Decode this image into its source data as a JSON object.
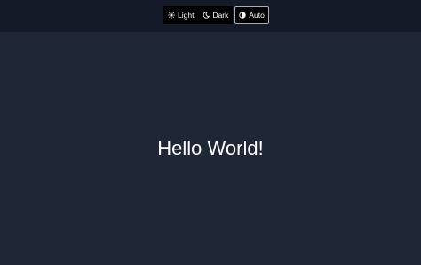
{
  "theme_switch": {
    "options": [
      {
        "label": "Light",
        "icon": "sun-icon"
      },
      {
        "label": "Dark",
        "icon": "moon-icon"
      },
      {
        "label": "Auto",
        "icon": "half-circle-icon"
      }
    ],
    "selected": "Auto"
  },
  "main": {
    "heading": "Hello World!"
  },
  "colors": {
    "background": "#1f2636",
    "topbar": "#141a28",
    "text": "#ffffff"
  }
}
